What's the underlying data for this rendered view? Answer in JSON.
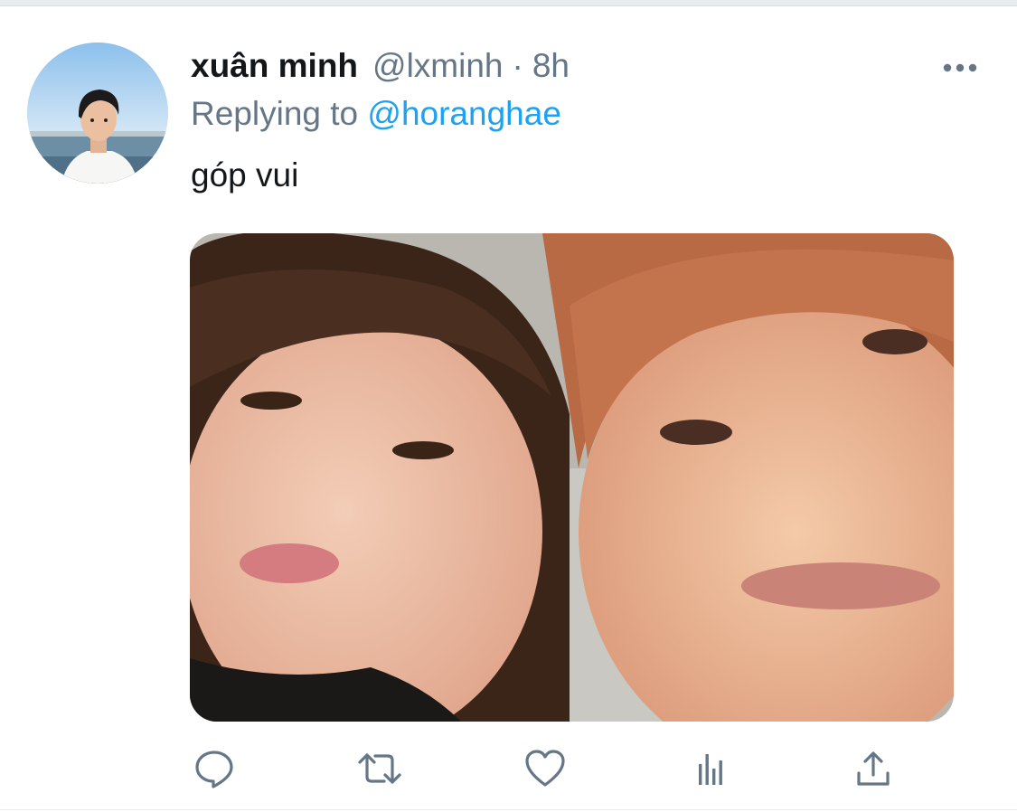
{
  "tweet": {
    "display_name": "xuân minh",
    "handle": "@lxminh",
    "separator": "·",
    "time": "8h",
    "reply_prefix": "Replying to",
    "reply_to": "@horanghae",
    "text": "góp vui",
    "more_icon": "more-horizontal-icon"
  },
  "actions": [
    {
      "name": "reply",
      "icon": "comment-icon"
    },
    {
      "name": "retweet",
      "icon": "retweet-icon"
    },
    {
      "name": "like",
      "icon": "heart-icon"
    },
    {
      "name": "analytics",
      "icon": "bar-chart-icon"
    },
    {
      "name": "share",
      "icon": "share-icon"
    }
  ],
  "colors": {
    "text_primary": "#14171a",
    "text_secondary": "#657786",
    "link": "#1da1f2",
    "icon": "#657786",
    "divider": "#e6ecf0"
  }
}
